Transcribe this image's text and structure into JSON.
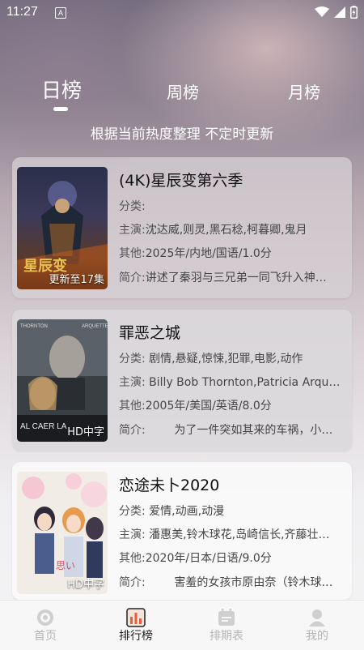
{
  "status_bar": {
    "time": "11:27",
    "notification_badge": "A",
    "icons": [
      "wifi-icon",
      "signal-icon",
      "battery-icon"
    ]
  },
  "tabs": [
    {
      "label": "日榜",
      "active": true
    },
    {
      "label": "周榜",
      "active": false
    },
    {
      "label": "月榜",
      "active": false
    }
  ],
  "subtitle": "根据当前热度整理 不定时更新",
  "items": [
    {
      "title": "(4K)星辰变第六季",
      "badge": "更新至17集",
      "genre_label": "分类:",
      "genre_value": "",
      "cast_label": "主演:",
      "cast_value": "沈达威,则灵,黑石稔,柯暮卿,鬼月",
      "other_label": "其他:",
      "other_value": "2025年/内地/国语/1.0分",
      "intro_label": "简介:",
      "intro_value": "讲述了秦羽与三兄弟一同飞升入神…"
    },
    {
      "title": "罪恶之城",
      "badge": "HD中字",
      "genre_label": "分类:",
      "genre_value": "剧情,悬疑,惊悚,犯罪,电影,动作",
      "cast_label": "主演:",
      "cast_value": "Billy Bob Thornton,Patricia Arquet…",
      "other_label": "其他:",
      "other_value": "2005年/美国/英语/8.0分",
      "intro_label": "简介:",
      "intro_value": "为了一件突如其来的车祸，小…"
    },
    {
      "title": "恋途未卜2020",
      "badge": "HD中字",
      "genre_label": "分类:",
      "genre_value": "爱情,动画,动漫",
      "cast_label": "主演:",
      "cast_value": "潘惠美,铃木球花,岛崎信长,齐藤壮…",
      "other_label": "其他:",
      "other_value": "2020年/日本/日语/9.0分",
      "intro_label": "简介:",
      "intro_value": "害羞的女孩市原由奈（铃木球…"
    }
  ],
  "nav": [
    {
      "label": "首页",
      "icon": "home-icon",
      "active": false
    },
    {
      "label": "排行榜",
      "icon": "ranking-icon",
      "active": true
    },
    {
      "label": "排期表",
      "icon": "calendar-icon",
      "active": false
    },
    {
      "label": "我的",
      "icon": "profile-icon",
      "active": false
    }
  ],
  "colors": {
    "accent": "#e85d3a",
    "text_primary": "#111111",
    "nav_inactive": "#b5b5b5"
  }
}
